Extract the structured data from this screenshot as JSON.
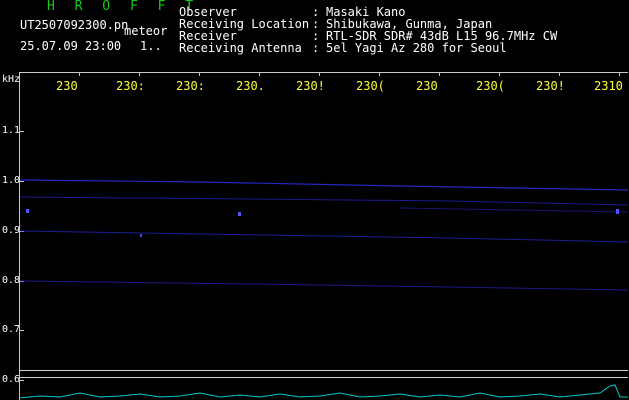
{
  "header": {
    "app_title": "H R O F F T",
    "filename": "UT2507092300.pn",
    "event_type": "meteor",
    "timestamp": "25.07.09 23:00",
    "counter": "1.."
  },
  "station_info": [
    {
      "label": "Observer",
      "colon": ":",
      "value": "Masaki Kano"
    },
    {
      "label": "Receiving Location",
      "colon": ":",
      "value": "Shibukawa, Gunma, Japan"
    },
    {
      "label": "Receiver",
      "colon": ":",
      "value": "RTL-SDR SDR# 43dB L15 96.7MHz CW"
    },
    {
      "label": "Receiving Antenna",
      "colon": ":",
      "value": "5el Yagi Az 280 for Seoul"
    }
  ],
  "plot": {
    "unit_label": "kHz",
    "y_ticks": [
      "1.1",
      "1.0",
      "0.9",
      "0.8",
      "0.7",
      "0.6"
    ],
    "x_ticks": [
      "230",
      "230:",
      "230:",
      "230.",
      "230!",
      "230(",
      "230",
      "230(",
      "230!",
      "2310"
    ]
  },
  "colors": {
    "title": "#19c819",
    "label": "#ffffff",
    "tick": "#ffff3a",
    "trace": "#3030ff",
    "spectrum": "#00c8c8"
  }
}
